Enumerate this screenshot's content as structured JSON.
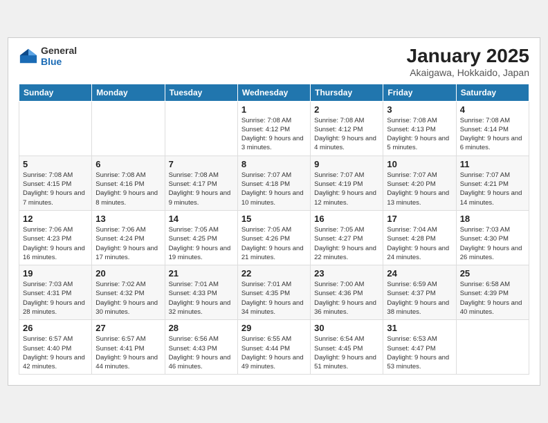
{
  "header": {
    "logo_line1": "General",
    "logo_line2": "Blue",
    "month": "January 2025",
    "location": "Akaigawa, Hokkaido, Japan"
  },
  "weekdays": [
    "Sunday",
    "Monday",
    "Tuesday",
    "Wednesday",
    "Thursday",
    "Friday",
    "Saturday"
  ],
  "weeks": [
    [
      {
        "day": "",
        "info": ""
      },
      {
        "day": "",
        "info": ""
      },
      {
        "day": "",
        "info": ""
      },
      {
        "day": "1",
        "info": "Sunrise: 7:08 AM\nSunset: 4:12 PM\nDaylight: 9 hours and 3 minutes."
      },
      {
        "day": "2",
        "info": "Sunrise: 7:08 AM\nSunset: 4:12 PM\nDaylight: 9 hours and 4 minutes."
      },
      {
        "day": "3",
        "info": "Sunrise: 7:08 AM\nSunset: 4:13 PM\nDaylight: 9 hours and 5 minutes."
      },
      {
        "day": "4",
        "info": "Sunrise: 7:08 AM\nSunset: 4:14 PM\nDaylight: 9 hours and 6 minutes."
      }
    ],
    [
      {
        "day": "5",
        "info": "Sunrise: 7:08 AM\nSunset: 4:15 PM\nDaylight: 9 hours and 7 minutes."
      },
      {
        "day": "6",
        "info": "Sunrise: 7:08 AM\nSunset: 4:16 PM\nDaylight: 9 hours and 8 minutes."
      },
      {
        "day": "7",
        "info": "Sunrise: 7:08 AM\nSunset: 4:17 PM\nDaylight: 9 hours and 9 minutes."
      },
      {
        "day": "8",
        "info": "Sunrise: 7:07 AM\nSunset: 4:18 PM\nDaylight: 9 hours and 10 minutes."
      },
      {
        "day": "9",
        "info": "Sunrise: 7:07 AM\nSunset: 4:19 PM\nDaylight: 9 hours and 12 minutes."
      },
      {
        "day": "10",
        "info": "Sunrise: 7:07 AM\nSunset: 4:20 PM\nDaylight: 9 hours and 13 minutes."
      },
      {
        "day": "11",
        "info": "Sunrise: 7:07 AM\nSunset: 4:21 PM\nDaylight: 9 hours and 14 minutes."
      }
    ],
    [
      {
        "day": "12",
        "info": "Sunrise: 7:06 AM\nSunset: 4:23 PM\nDaylight: 9 hours and 16 minutes."
      },
      {
        "day": "13",
        "info": "Sunrise: 7:06 AM\nSunset: 4:24 PM\nDaylight: 9 hours and 17 minutes."
      },
      {
        "day": "14",
        "info": "Sunrise: 7:05 AM\nSunset: 4:25 PM\nDaylight: 9 hours and 19 minutes."
      },
      {
        "day": "15",
        "info": "Sunrise: 7:05 AM\nSunset: 4:26 PM\nDaylight: 9 hours and 21 minutes."
      },
      {
        "day": "16",
        "info": "Sunrise: 7:05 AM\nSunset: 4:27 PM\nDaylight: 9 hours and 22 minutes."
      },
      {
        "day": "17",
        "info": "Sunrise: 7:04 AM\nSunset: 4:28 PM\nDaylight: 9 hours and 24 minutes."
      },
      {
        "day": "18",
        "info": "Sunrise: 7:03 AM\nSunset: 4:30 PM\nDaylight: 9 hours and 26 minutes."
      }
    ],
    [
      {
        "day": "19",
        "info": "Sunrise: 7:03 AM\nSunset: 4:31 PM\nDaylight: 9 hours and 28 minutes."
      },
      {
        "day": "20",
        "info": "Sunrise: 7:02 AM\nSunset: 4:32 PM\nDaylight: 9 hours and 30 minutes."
      },
      {
        "day": "21",
        "info": "Sunrise: 7:01 AM\nSunset: 4:33 PM\nDaylight: 9 hours and 32 minutes."
      },
      {
        "day": "22",
        "info": "Sunrise: 7:01 AM\nSunset: 4:35 PM\nDaylight: 9 hours and 34 minutes."
      },
      {
        "day": "23",
        "info": "Sunrise: 7:00 AM\nSunset: 4:36 PM\nDaylight: 9 hours and 36 minutes."
      },
      {
        "day": "24",
        "info": "Sunrise: 6:59 AM\nSunset: 4:37 PM\nDaylight: 9 hours and 38 minutes."
      },
      {
        "day": "25",
        "info": "Sunrise: 6:58 AM\nSunset: 4:39 PM\nDaylight: 9 hours and 40 minutes."
      }
    ],
    [
      {
        "day": "26",
        "info": "Sunrise: 6:57 AM\nSunset: 4:40 PM\nDaylight: 9 hours and 42 minutes."
      },
      {
        "day": "27",
        "info": "Sunrise: 6:57 AM\nSunset: 4:41 PM\nDaylight: 9 hours and 44 minutes."
      },
      {
        "day": "28",
        "info": "Sunrise: 6:56 AM\nSunset: 4:43 PM\nDaylight: 9 hours and 46 minutes."
      },
      {
        "day": "29",
        "info": "Sunrise: 6:55 AM\nSunset: 4:44 PM\nDaylight: 9 hours and 49 minutes."
      },
      {
        "day": "30",
        "info": "Sunrise: 6:54 AM\nSunset: 4:45 PM\nDaylight: 9 hours and 51 minutes."
      },
      {
        "day": "31",
        "info": "Sunrise: 6:53 AM\nSunset: 4:47 PM\nDaylight: 9 hours and 53 minutes."
      },
      {
        "day": "",
        "info": ""
      }
    ]
  ]
}
